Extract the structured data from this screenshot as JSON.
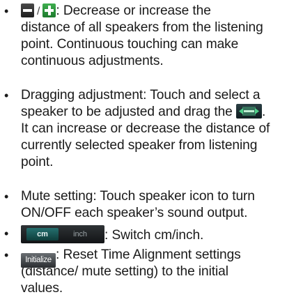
{
  "bullet_glyph": "•",
  "items": [
    {
      "icons": [
        "minus-button-icon",
        "plus-button-icon"
      ],
      "slash": "/",
      "lines": [
        ": Decrease or increase the",
        "distance of all speakers from the listening",
        "point.  Continuous touching can make",
        "continuous adjustments."
      ]
    },
    {
      "icons": [
        "drag-handle-icon"
      ],
      "lines": [
        "Dragging adjustment: Touch and select a",
        "speaker to be adjusted and drag the",
        ".",
        "It can increase or decrease the distance of",
        "currently selected speaker from listening",
        "point."
      ]
    },
    {
      "lines": [
        "Mute setting: Touch speaker icon to turn",
        "ON/OFF each speaker’s sound output."
      ]
    },
    {
      "toggle": {
        "cm": "cm",
        "inch": "inch"
      },
      "lines": [
        ": Switch cm/inch."
      ]
    },
    {
      "button_label": "Initialize",
      "lines": [
        ": Reset Time Alignment settings",
        "(distance/ mute setting) to the initial",
        "values."
      ]
    }
  ],
  "colors": {
    "text": "#1a1a1a",
    "plus_button": "#2e9540",
    "minus_button": "#2e2e2e",
    "cm_active": "#1d5c5b"
  }
}
